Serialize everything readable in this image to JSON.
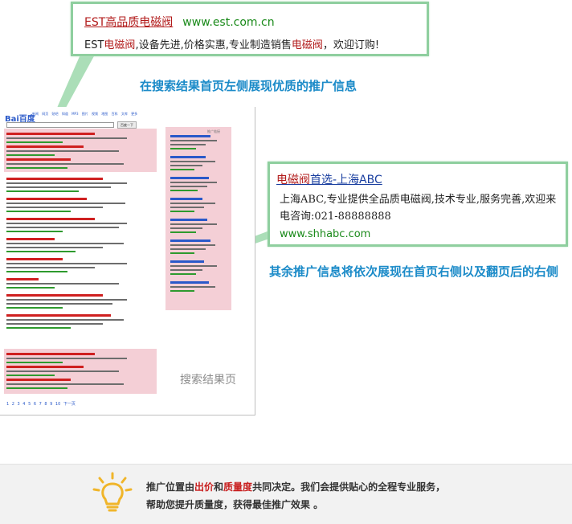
{
  "top_callout": {
    "brand": "EST高品质电磁阀",
    "url": "www.est.com.cn",
    "desc_prefix": "EST",
    "desc_hl1": "电磁阀",
    "desc_mid": ",设备先进,价格实惠,专业制造销售",
    "desc_hl2": "电磁阀",
    "desc_suffix": "，欢迎订购!"
  },
  "caption_top": "在搜索结果首页左侧展现优质的推广信息",
  "screenshot": {
    "logo": "Bai百度",
    "search_value": "电磁阀",
    "search_button": "百度一下",
    "nav": "新闻 网页 贴吧 知道 MP3 图片 视频 地图 百科 文库 更多",
    "ad_label": "推广链接",
    "label": "搜索结果页",
    "pager": "1 2 3 4 5 6 7 8 9 10 下一页"
  },
  "right_callout": {
    "title_hl": "电磁阀",
    "title_rest": "首选-上海ABC",
    "desc": "上海ABC,专业提供全品质电磁阀,技术专业,服务完善,欢迎来电咨询:021-88888888",
    "url": "www.shhabc.com"
  },
  "caption_right": "其余推广信息将依次展现在首页右侧以及翻页后的右侧",
  "bottom": {
    "p1": "推广位置由",
    "red1": "出价",
    "p2": "和",
    "red2": "质量度",
    "p3": "共同决定。我们会提供贴心的全程专业服务，",
    "line2": "帮助您提升质量度，获得最佳推广效果 。"
  },
  "colors": {
    "accent_blue": "#1a8ac8",
    "ad_pink": "#f4cfd6",
    "callout_border": "#8fcf9f",
    "brand_red": "#b21b1b"
  }
}
